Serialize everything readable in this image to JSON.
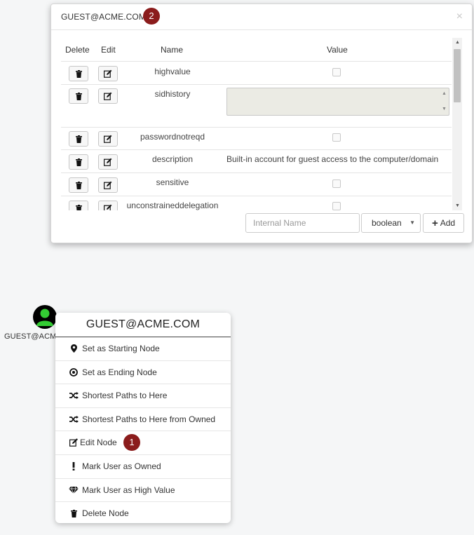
{
  "modal": {
    "title": "GUEST@ACME.COM",
    "step_badge": "2",
    "close_glyph": "×",
    "columns": {
      "delete": "Delete",
      "edit": "Edit",
      "name": "Name",
      "value": "Value"
    },
    "properties": [
      {
        "name": "highvalue",
        "value_type": "checkbox",
        "checked": false
      },
      {
        "name": "sidhistory",
        "value_type": "textarea",
        "value": ""
      },
      {
        "name": "passwordnotreqd",
        "value_type": "checkbox",
        "checked": false
      },
      {
        "name": "description",
        "value_type": "text",
        "value": "Built-in account for guest access to the computer/domain"
      },
      {
        "name": "sensitive",
        "value_type": "checkbox",
        "checked": false
      },
      {
        "name": "unconstraineddelegation",
        "value_type": "checkbox",
        "checked": false
      }
    ],
    "add_form": {
      "name_placeholder": "Internal Name",
      "type_selected": "boolean",
      "add_label": "Add"
    }
  },
  "node": {
    "label": "GUEST@ACM",
    "icon": "user-icon",
    "color": "#33cc33"
  },
  "context_menu": {
    "title": "GUEST@ACME.COM",
    "step_badge": "1",
    "items": [
      {
        "label": "Set as Starting Node",
        "icon": "map-marker-icon"
      },
      {
        "label": "Set as Ending Node",
        "icon": "bullseye-icon"
      },
      {
        "label": "Shortest Paths to Here",
        "icon": "random-icon"
      },
      {
        "label": "Shortest Paths to Here from Owned",
        "icon": "random-icon"
      },
      {
        "label": "Edit Node",
        "icon": "edit-icon"
      },
      {
        "label": "Mark User as Owned",
        "icon": "exclamation-icon"
      },
      {
        "label": "Mark User as High Value",
        "icon": "diamond-icon"
      },
      {
        "label": "Delete Node",
        "icon": "trash-icon"
      }
    ]
  },
  "colors": {
    "badge": "#8b1c1c",
    "node_green": "#33cc33"
  }
}
